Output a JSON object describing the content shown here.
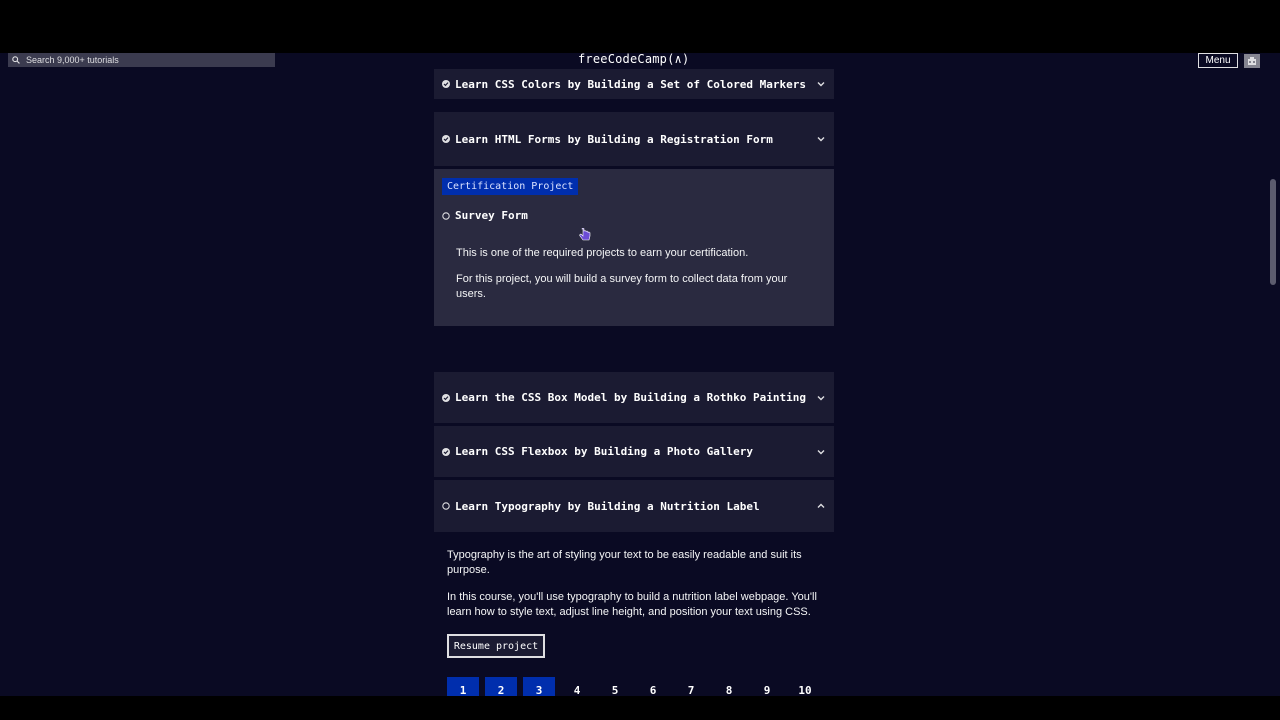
{
  "nav": {
    "search_placeholder": "Search 9,000+ tutorials",
    "logo": "freeCodeCamp(∧)",
    "menu_label": "Menu"
  },
  "blocks": {
    "colors": {
      "title": "Learn CSS Colors by Building a Set of Colored Markers",
      "status": "completed"
    },
    "forms": {
      "title": "Learn HTML Forms by Building a Registration Form",
      "status": "completed"
    },
    "box_model": {
      "title": "Learn the CSS Box Model by Building a Rothko Painting",
      "status": "completed"
    },
    "flexbox": {
      "title": "Learn CSS Flexbox by Building a Photo Gallery",
      "status": "completed"
    },
    "typography": {
      "title": "Learn Typography by Building a Nutrition Label",
      "status": "in-progress"
    }
  },
  "cert_project": {
    "tag": "Certification Project",
    "title": "Survey Form",
    "para1": "This is one of the required projects to earn your certification.",
    "para2": "For this project, you will build a survey form to collect data from your users."
  },
  "typography_detail": {
    "para1": "Typography is the art of styling your text to be easily readable and suit its purpose.",
    "para2": "In this course, you'll use typography to build a nutrition label webpage. You'll learn how to style text, adjust line height, and position your text using CSS.",
    "resume_label": "Resume project",
    "steps": [
      "1",
      "2",
      "3",
      "4",
      "5",
      "6",
      "7",
      "8",
      "9",
      "10"
    ],
    "completed_steps": 3
  },
  "colors": {
    "bg": "#0a0a23",
    "card": "#1b1b32",
    "expanded": "#2a2a40",
    "accent": "#002ead"
  }
}
